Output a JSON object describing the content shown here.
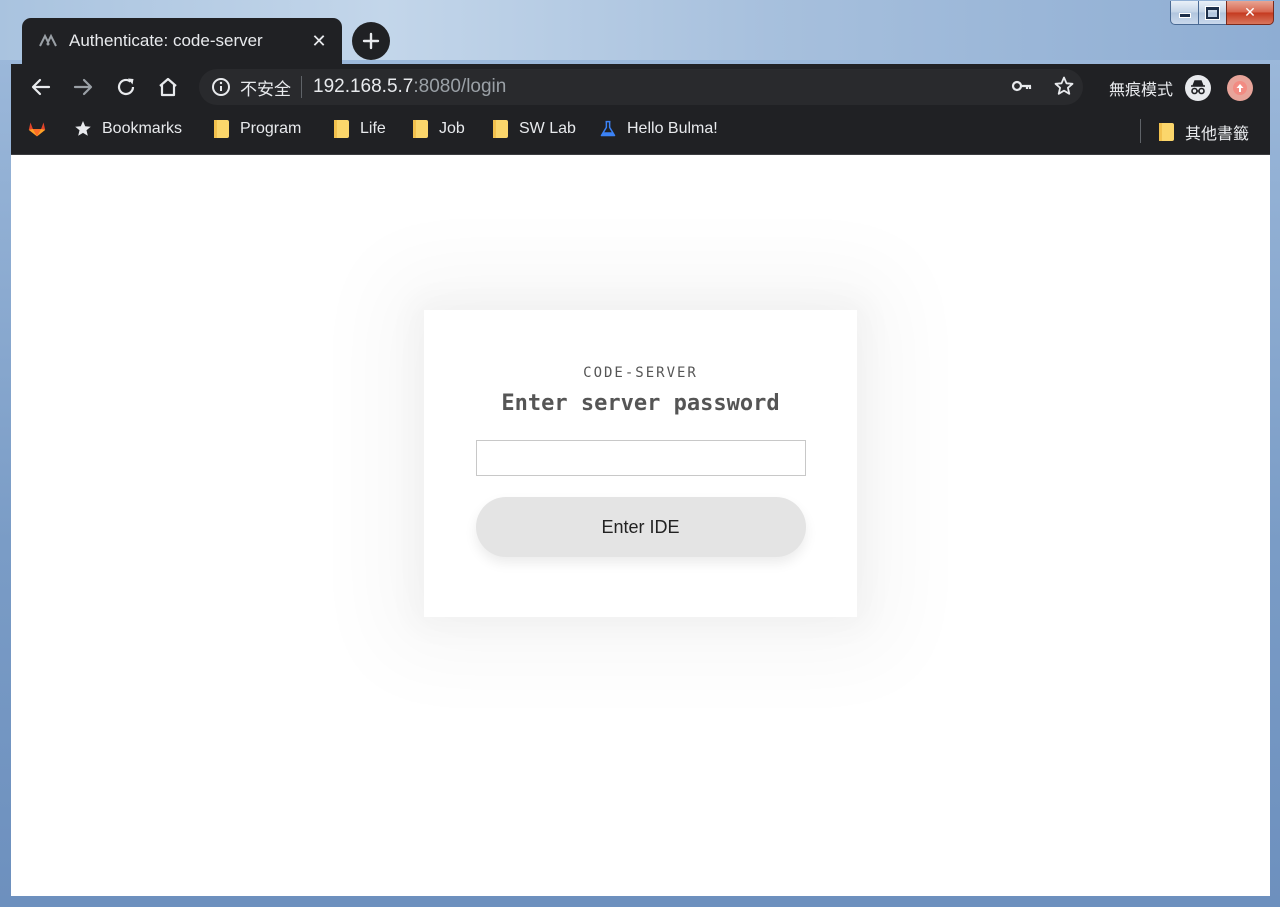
{
  "window": {
    "controls": [
      "minimize",
      "maximize",
      "close"
    ]
  },
  "tab": {
    "title": "Authenticate: code-server",
    "favicon": "code-server-icon",
    "close_glyph": "✕"
  },
  "toolbar": {
    "security_label": "不安全",
    "url_host": "192.168.5.7",
    "url_path": ":8080/login",
    "incognito_label": "無痕模式"
  },
  "bookmarks": {
    "items": [
      {
        "label": "Bookmarks",
        "icon": "star-icon"
      },
      {
        "label": "Program",
        "icon": "folder-icon"
      },
      {
        "label": "Life",
        "icon": "folder-icon"
      },
      {
        "label": "Job",
        "icon": "folder-icon"
      },
      {
        "label": "SW Lab",
        "icon": "folder-icon"
      },
      {
        "label": "Hello Bulma!",
        "icon": "flask-icon"
      }
    ],
    "other_label": "其他書籤"
  },
  "login": {
    "header": "CODE-SERVER",
    "subtitle": "Enter server password",
    "password_value": "",
    "submit_label": "Enter IDE"
  },
  "colors": {
    "chrome_dark": "#202124",
    "window_frame": "#7a9cc6",
    "button_bg": "#e4e4e4",
    "close_red": "#c4391f"
  }
}
